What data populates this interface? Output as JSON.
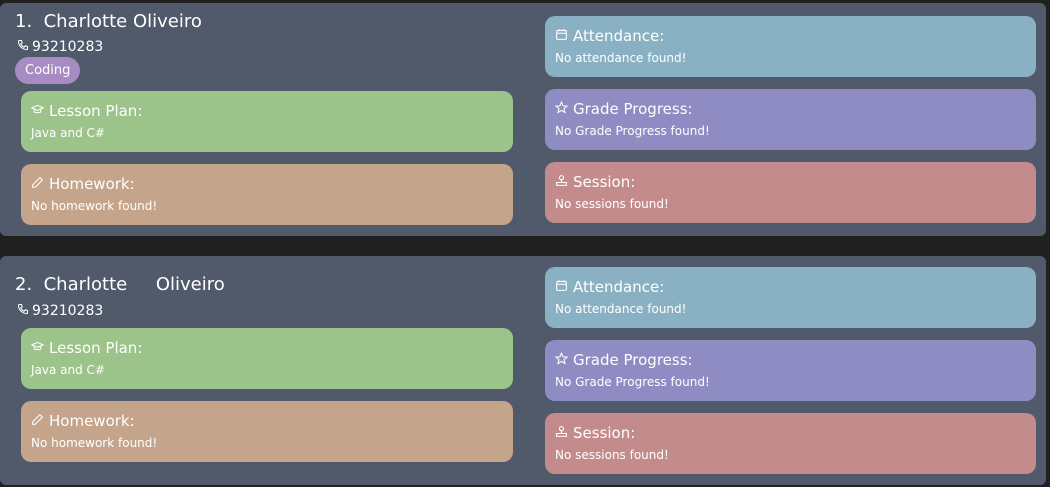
{
  "students": [
    {
      "name": "1.  Charlotte Oliveiro",
      "phone": "93210283",
      "tags": [
        "Coding"
      ],
      "lesson_plan": {
        "title": "Lesson Plan:",
        "text": "Java and C#"
      },
      "homework": {
        "title": "Homework:",
        "text": "No homework found!"
      },
      "attendance": {
        "title": "Attendance:",
        "text": "No attendance found!"
      },
      "grade_progress": {
        "title": "Grade Progress:",
        "text": "No Grade Progress found!"
      },
      "session": {
        "title": "Session:",
        "text": "No sessions found!"
      }
    },
    {
      "name": "2.  Charlotte     Oliveiro",
      "phone": "93210283",
      "tags": [],
      "lesson_plan": {
        "title": "Lesson Plan:",
        "text": "Java and C#"
      },
      "homework": {
        "title": "Homework:",
        "text": "No homework found!"
      },
      "attendance": {
        "title": "Attendance:",
        "text": "No attendance found!"
      },
      "grade_progress": {
        "title": "Grade Progress:",
        "text": "No Grade Progress found!"
      },
      "session": {
        "title": "Session:",
        "text": "No sessions found!"
      }
    }
  ],
  "colors": {
    "background": "#202020",
    "card": "#515a6b",
    "tag": "#a98bc3",
    "lesson_plan": "#9cc38a",
    "homework": "#c4a58b",
    "attendance": "#8ab1c3",
    "grade_progress": "#8f8cc3",
    "session": "#c48b8d"
  },
  "icons": {
    "phone": "phone-icon",
    "lesson_plan": "graduation-cap-icon",
    "homework": "pencil-icon",
    "attendance": "calendar-icon",
    "grade_progress": "star-icon",
    "session": "session-icon"
  }
}
